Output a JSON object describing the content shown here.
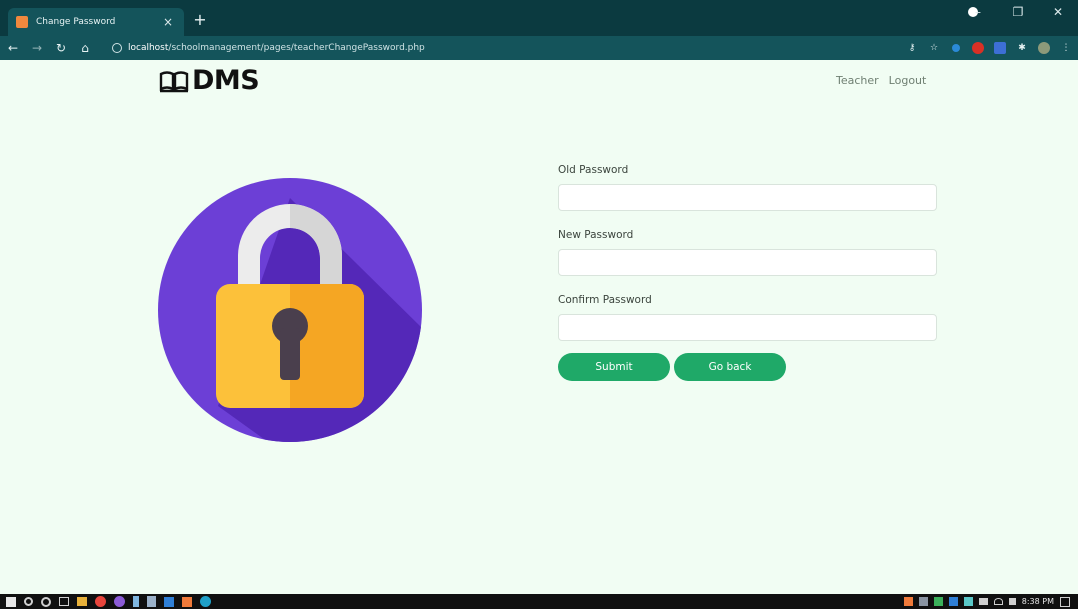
{
  "browser": {
    "tab_title": "Change Password",
    "tab_close": "×",
    "new_tab": "+",
    "url_host": "localhost",
    "url_path": "/schoolmanagement/pages/teacherChangePassword.php",
    "icons": [
      "back-icon",
      "forward-icon",
      "reload-icon",
      "home-icon",
      "info-icon",
      "key-icon",
      "star-icon",
      "extensions-icon",
      "profile-icon",
      "menu-icon"
    ]
  },
  "page": {
    "brand": "DMS",
    "nav": {
      "teacher": "Teacher",
      "logout": "Logout"
    },
    "form": {
      "old_password_label": "Old Password",
      "new_password_label": "New Password",
      "confirm_password_label": "Confirm Password",
      "submit_label": "Submit",
      "goback_label": "Go back"
    },
    "colors": {
      "accent": "#1fa968",
      "background": "#f1fdf3",
      "lock_circle": "#6c3fd6",
      "lock_body": "#f5a623"
    }
  },
  "taskbar": {
    "clock": "8:38 PM"
  }
}
